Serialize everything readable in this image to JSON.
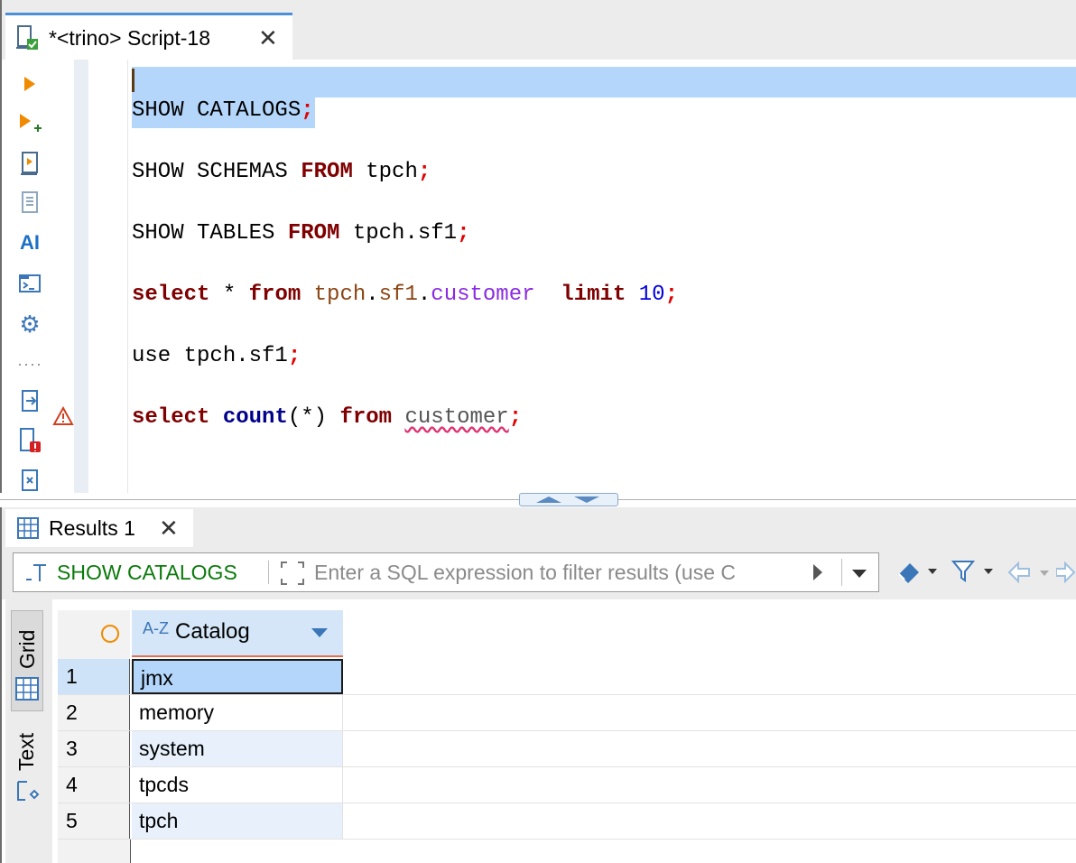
{
  "script_tab": {
    "title": "*<trino> Script-18",
    "close": "✕"
  },
  "editor": {
    "lines": [
      {
        "id": "l1",
        "text": "SHOW CATALOGS"
      },
      {
        "id": "l2a",
        "text": "SHOW SCHEMAS "
      },
      {
        "id": "l2b",
        "text": "FROM"
      },
      {
        "id": "l2c",
        "text": " tpch"
      },
      {
        "id": "l3a",
        "text": "SHOW TABLES "
      },
      {
        "id": "l3b",
        "text": "FROM"
      },
      {
        "id": "l3c",
        "text": " tpch.sf1"
      },
      {
        "id": "l4a",
        "text": "select"
      },
      {
        "id": "l4b",
        "text": " * "
      },
      {
        "id": "l4c",
        "text": "from"
      },
      {
        "id": "l4d",
        "text": "tpch"
      },
      {
        "id": "l4e",
        "text": "sf1"
      },
      {
        "id": "l4f",
        "text": "customer"
      },
      {
        "id": "l4g",
        "text": "limit"
      },
      {
        "id": "l4h",
        "text": "10"
      },
      {
        "id": "l5a",
        "text": "use tpch.sf1"
      },
      {
        "id": "l6a",
        "text": "select"
      },
      {
        "id": "l6b",
        "text": "count"
      },
      {
        "id": "l6c",
        "text": "(*) "
      },
      {
        "id": "l6d",
        "text": "from"
      },
      {
        "id": "l6e",
        "text": "customer"
      }
    ],
    "semicolon": ";",
    "dot": "."
  },
  "left_toolbar": {
    "icons": [
      "execute-statement-icon",
      "execute-in-new-tab-icon",
      "execute-script-icon",
      "explain-plan-icon",
      "ai-icon",
      "console-icon",
      "settings-icon",
      "more-icon",
      "export-icon",
      "problems-file-icon",
      "format-icon"
    ],
    "ai_label": "AI"
  },
  "results_tab": {
    "title": "Results 1",
    "close": "✕"
  },
  "filter": {
    "query": "SHOW CATALOGS",
    "placeholder": "Enter a SQL expression to filter results (use C"
  },
  "side_tabs": {
    "grid": "Grid",
    "text": "Text"
  },
  "grid": {
    "column": {
      "type_badge": "A-Z",
      "name": "Catalog"
    },
    "rows": [
      {
        "num": "1",
        "value": "jmx"
      },
      {
        "num": "2",
        "value": "memory"
      },
      {
        "num": "3",
        "value": "system"
      },
      {
        "num": "4",
        "value": "tpcds"
      },
      {
        "num": "5",
        "value": "tpch"
      }
    ]
  },
  "colors": {
    "keyword": "#7f0000",
    "selection": "#b4d6fb",
    "accent": "#4a90d9",
    "query": "#0b7a0b"
  }
}
